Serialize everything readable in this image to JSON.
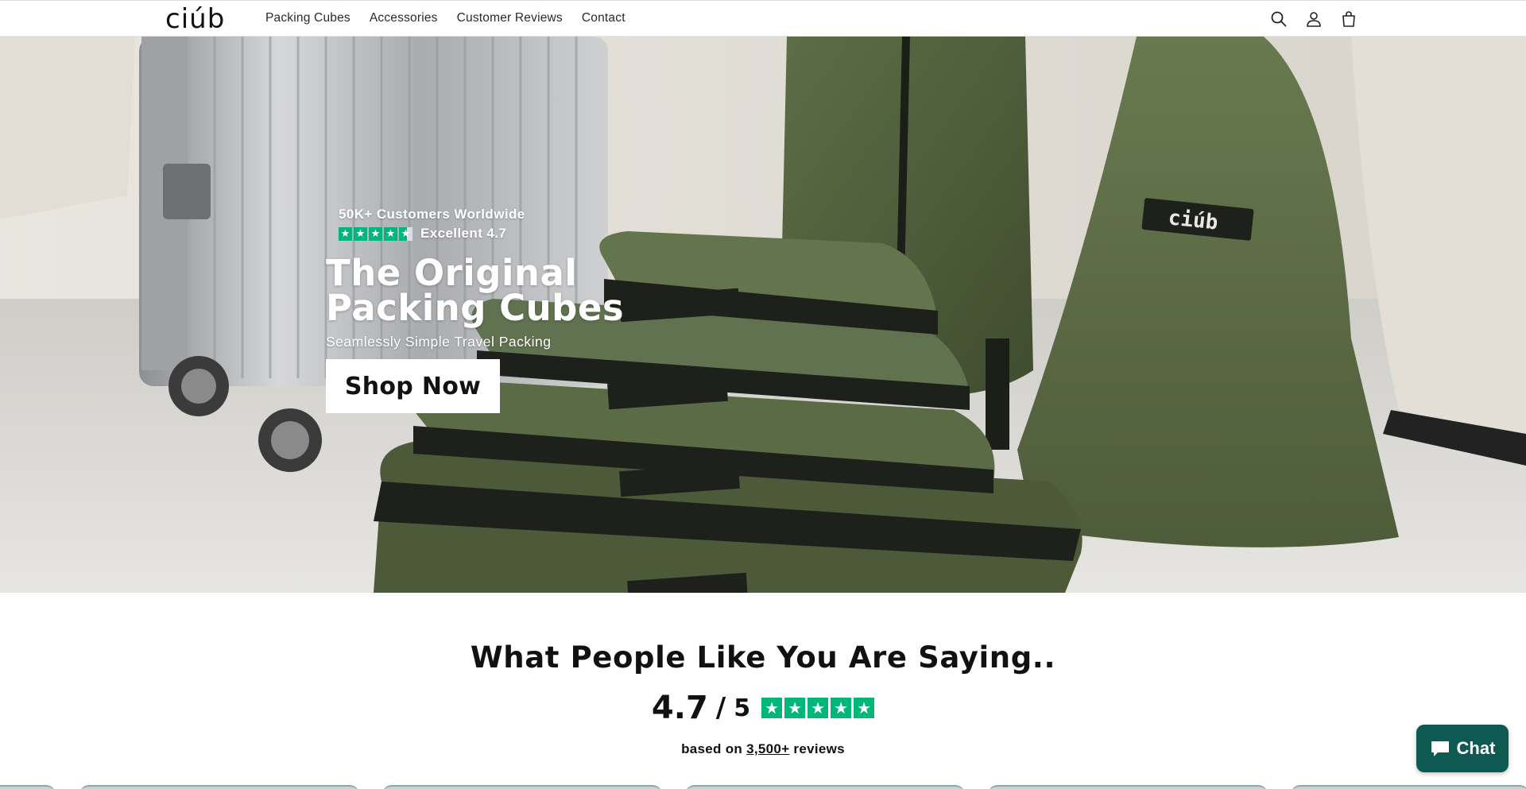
{
  "header": {
    "logo": "ciúb",
    "nav": [
      "Packing Cubes",
      "Accessories",
      "Customer Reviews",
      "Contact"
    ],
    "icons": [
      "search-icon",
      "account-icon",
      "cart-icon"
    ]
  },
  "hero": {
    "customers": "50K+ Customers Worldwide",
    "rating_text": "Excellent 4.7",
    "title": "The Original Packing Cubes",
    "subtitle": "Seamlessly Simple Travel Packing",
    "cta": "Shop Now",
    "bag_label": "ciúb"
  },
  "reviews": {
    "heading": "What People Like You Are Saying..",
    "score": "4.7",
    "slash": "/",
    "max": "5",
    "based_prefix": "based on ",
    "count": "3,500+",
    "based_suffix": " reviews"
  },
  "chat": {
    "label": "Chat"
  },
  "colors": {
    "trustpilot_green": "#00b67a",
    "chat_bg": "#0e5a53",
    "olive": "#5a6b45"
  }
}
